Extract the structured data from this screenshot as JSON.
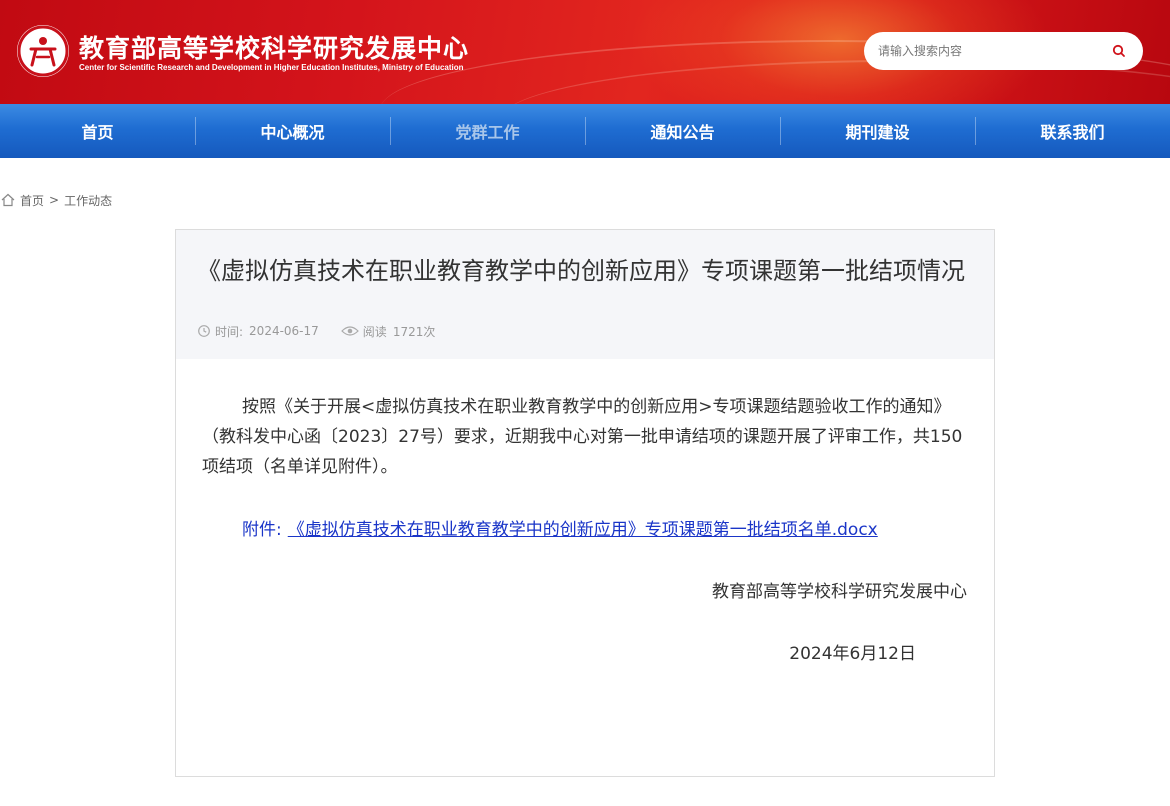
{
  "header": {
    "title": "教育部高等学校科学研究发展中心",
    "subtitle": "Center for Scientific Research and Development in Higher Education Institutes, Ministry of Education",
    "logo_icon": "logo-emblem-icon",
    "search": {
      "placeholder": "请输入搜索内容",
      "value": "",
      "icon": "search-icon"
    }
  },
  "nav": {
    "items": [
      {
        "label": "首页"
      },
      {
        "label": "中心概况"
      },
      {
        "label": "党群工作"
      },
      {
        "label": "通知公告"
      },
      {
        "label": "期刊建设"
      },
      {
        "label": "联系我们"
      }
    ]
  },
  "breadcrumb": {
    "home_icon": "home-icon",
    "home": "首页",
    "separator": ">",
    "current": "工作动态"
  },
  "article": {
    "title": "《虚拟仿真技术在职业教育教学中的创新应用》专项课题第一批结项情况",
    "meta": {
      "time_label": "时间:",
      "time_value": "2024-06-17",
      "views_label": "阅读",
      "views_value": "1721次"
    },
    "body": "按照《关于开展<虚拟仿真技术在职业教育教学中的创新应用>专项课题结题验收工作的通知》（教科发中心函〔2023〕27号）要求，近期我中心对第一批申请结项的课题开展了评审工作，共150项结项（名单详见附件）。",
    "attachment_label": "附件:",
    "attachment_link": "《虚拟仿真技术在职业教育教学中的创新应用》专项课题第一批结项名单.docx",
    "signature_org": "教育部高等学校科学研究发展中心",
    "signature_date": "2024年6月12日"
  },
  "colors": {
    "header_red": "#d4141b",
    "nav_blue": "#1f6dd2",
    "link_blue": "#1a35c8",
    "meta_gray": "#999999"
  }
}
